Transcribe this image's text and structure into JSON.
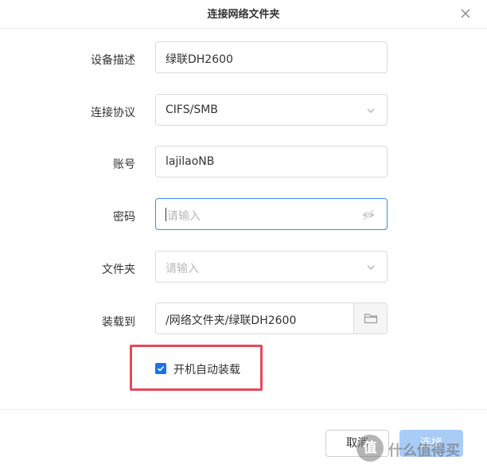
{
  "dialog": {
    "title": "连接网络文件夹",
    "close_icon": "close-icon"
  },
  "form": {
    "device_description": {
      "label": "设备描述",
      "value": "绿联DH2600"
    },
    "protocol": {
      "label": "连接协议",
      "value": "CIFS/SMB",
      "icon": "chevron-down-icon"
    },
    "account": {
      "label": "账号",
      "value": "lajilaoNB"
    },
    "password": {
      "label": "密码",
      "placeholder": "请输入",
      "icon": "eye-hidden-icon"
    },
    "folder": {
      "label": "文件夹",
      "placeholder": "请输入",
      "icon": "chevron-down-icon"
    },
    "mount_to": {
      "label": "装载到",
      "value": "/网络文件夹/绿联DH2600",
      "icon": "folder-icon"
    },
    "auto_mount": {
      "label": "开机自动装载",
      "checked": true
    }
  },
  "footer": {
    "cancel_label": "取消",
    "confirm_label": "连接"
  },
  "watermark": {
    "logo_text": "值",
    "text": "什么值得买"
  },
  "colors": {
    "accent": "#1a73e8",
    "focus_border": "#3b8cf5",
    "highlight_box": "#e8475b",
    "disabled_button": "#a9ccf7"
  }
}
